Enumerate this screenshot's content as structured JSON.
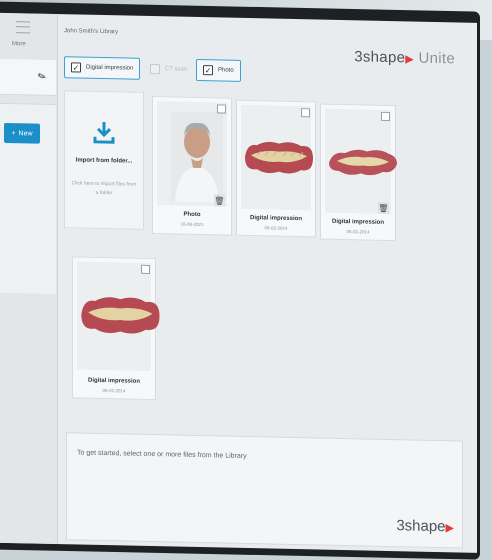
{
  "sidebar": {
    "more_label": "More",
    "new_button_label": "New"
  },
  "header": {
    "library_title": "John Smith's Library",
    "logo_text": "3shape",
    "logo_product": "Unite"
  },
  "filters": [
    {
      "label": "Digital impression",
      "checked": true,
      "enabled": true
    },
    {
      "label": "CT scan",
      "checked": false,
      "enabled": false
    },
    {
      "label": "Photo",
      "checked": true,
      "enabled": true
    }
  ],
  "import_tile": {
    "title": "Import from folder...",
    "hint": "Click here to import files from a folder"
  },
  "files": [
    {
      "name": "Photo",
      "date": "16-08-2021",
      "kind": "photo"
    },
    {
      "name": "Digital impression",
      "date": "06-02-2014",
      "kind": "impression"
    },
    {
      "name": "Digital impression",
      "date": "06-02-2014",
      "kind": "impression"
    },
    {
      "name": "Digital impression",
      "date": "06-02-2014",
      "kind": "impression"
    }
  ],
  "footer": {
    "message": "To get started, select one or more files from the Library",
    "logo_text": "3shape"
  },
  "colors": {
    "accent_blue": "#1b8fc7",
    "brand_red": "#e23c3c"
  },
  "icons": {
    "import": "download-arrow-icon",
    "delete": "trash-icon",
    "edit": "pencil-icon",
    "more": "hamburger-icon"
  }
}
